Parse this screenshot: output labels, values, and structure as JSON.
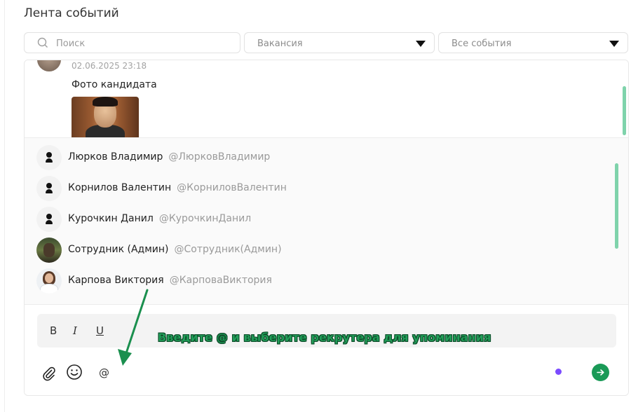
{
  "page": {
    "title": "Лента событий"
  },
  "filters": {
    "search_placeholder": "Поиск",
    "vacancy_select": "Вакансия",
    "events_select": "Все события"
  },
  "feed": {
    "item": {
      "date": "02.06.2025 23:18",
      "text": "Фото кандидата"
    }
  },
  "mention_list": [
    {
      "name": "Люрков Владимир",
      "handle": "@ЛюрковВладимир",
      "avatar": "user-glyph-icon"
    },
    {
      "name": "Корнилов Валентин",
      "handle": "@КорниловВалентин",
      "avatar": "user-glyph-icon"
    },
    {
      "name": "Курочкин Данил",
      "handle": "@КурочкинДанил",
      "avatar": "user-glyph-icon"
    },
    {
      "name": "Сотрудник (Админ)",
      "handle": "@Сотрудник(Админ)",
      "avatar": "photo"
    },
    {
      "name": "Карпова Виктория",
      "handle": "@КарповаВиктория",
      "avatar": "photo"
    }
  ],
  "composer": {
    "toolbar": {
      "bold": "B",
      "italic": "I",
      "underline": "U"
    },
    "input_value": "@",
    "annotation": "Введите @ и выберите рекрутера для упоминания"
  },
  "colors": {
    "accent": "#1a9a57",
    "scrollbar": "#7fd3ab",
    "dot": "#7b4bff",
    "annotation": "#22a05a"
  }
}
